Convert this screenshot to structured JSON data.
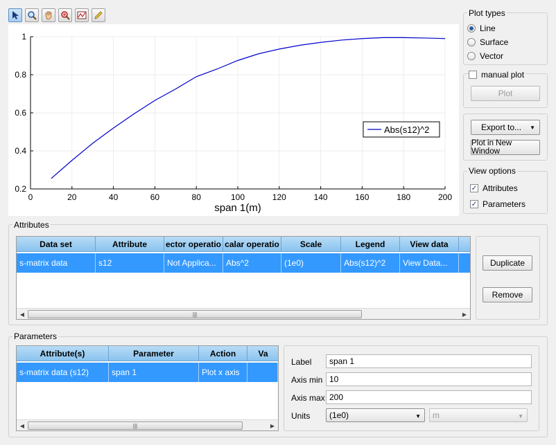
{
  "toolbar": {
    "tools": [
      {
        "name": "pointer-icon",
        "active": true
      },
      {
        "name": "zoom-icon",
        "active": false
      },
      {
        "name": "pan-icon",
        "active": false
      },
      {
        "name": "zoom-region-icon",
        "active": false
      },
      {
        "name": "data-cursor-icon",
        "active": false
      },
      {
        "name": "pencil-icon",
        "active": false
      }
    ]
  },
  "chart_data": {
    "type": "line",
    "xlabel": "span 1(m)",
    "ylabel": "",
    "xlim": [
      0,
      200
    ],
    "ylim": [
      0.2,
      1
    ],
    "xticks": [
      "0",
      "20",
      "40",
      "60",
      "80",
      "100",
      "120",
      "140",
      "160",
      "180",
      "200"
    ],
    "yticks": [
      "0.2",
      "0.4",
      "0.6",
      "0.8",
      "1"
    ],
    "grid": true,
    "legend_position": "middle-right",
    "series": [
      {
        "name": "Abs(s12)^2",
        "color": "#0000cc",
        "x": [
          10,
          20,
          30,
          40,
          50,
          60,
          70,
          80,
          90,
          100,
          110,
          120,
          130,
          140,
          150,
          160,
          170,
          180,
          190,
          200
        ],
        "y": [
          0.255,
          0.35,
          0.44,
          0.52,
          0.595,
          0.665,
          0.725,
          0.79,
          0.83,
          0.875,
          0.91,
          0.935,
          0.955,
          0.97,
          0.982,
          0.99,
          0.995,
          0.995,
          0.993,
          0.99
        ]
      }
    ]
  },
  "plot_types": {
    "title": "Plot types",
    "options": [
      {
        "label": "Line",
        "selected": true
      },
      {
        "label": "Surface",
        "selected": false
      },
      {
        "label": "Vector",
        "selected": false
      }
    ]
  },
  "manual_plot": {
    "label": "manual plot",
    "checked": false,
    "plot_button": "Plot"
  },
  "export": {
    "export_button": "Export to...",
    "new_window_button": "Plot in New Window"
  },
  "view_options": {
    "title": "View options",
    "attributes": {
      "label": "Attributes",
      "checked": true
    },
    "parameters": {
      "label": "Parameters",
      "checked": true
    }
  },
  "attributes": {
    "title": "Attributes",
    "columns": [
      "Data set",
      "Attribute",
      "ector operatio",
      "calar operatio",
      "Scale",
      "Legend",
      "View data"
    ],
    "rows": [
      [
        "s-matrix data",
        "s12",
        "Not Applica...",
        "Abs^2",
        "(1e0)",
        "Abs(s12)^2",
        "View Data..."
      ]
    ],
    "duplicate_button": "Duplicate",
    "remove_button": "Remove"
  },
  "parameters": {
    "title": "Parameters",
    "columns": [
      "Attribute(s)",
      "Parameter",
      "Action",
      "Va"
    ],
    "rows": [
      [
        "s-matrix data (s12)",
        "span 1",
        "Plot x axis",
        ""
      ]
    ],
    "form": {
      "label_caption": "Label",
      "label_value": "span 1",
      "axis_min_caption": "Axis min",
      "axis_min_value": "10",
      "axis_max_caption": "Axis max",
      "axis_max_value": "200",
      "units_caption": "Units",
      "units_value": "(1e0)",
      "unit_value": "m"
    }
  }
}
